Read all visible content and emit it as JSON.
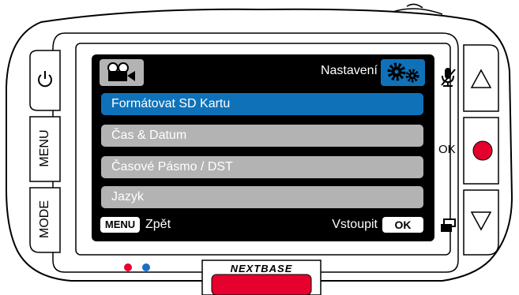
{
  "header": {
    "title": "Nastavení",
    "mode_icon": "video-camera-icon",
    "settings_icon": "gears-icon"
  },
  "menu": {
    "items": [
      {
        "label": "Formátovat SD Kartu",
        "selected": true
      },
      {
        "label": "Čas & Datum",
        "selected": false
      },
      {
        "label": "Časové Pásmo / DST",
        "selected": false
      },
      {
        "label": "Jazyk",
        "selected": false
      }
    ]
  },
  "footer": {
    "left_key": "MENU",
    "left_label": "Zpět",
    "right_label": "Vstoupit",
    "right_key": "OK"
  },
  "buttons": {
    "power_icon": "power-icon",
    "menu": "MENU",
    "mode": "MODE",
    "ok": "OK",
    "mic_icon": "mic-muted-icon",
    "up_icon": "triangle-up-icon",
    "down_icon": "triangle-down-icon",
    "protect_icon": "file-protect-icon"
  },
  "brand": {
    "logo": "NEXTBASE",
    "led_colors": [
      "#e6002d",
      "#1a6fc4"
    ],
    "accent": "#0f72b9",
    "record": "#e6002d"
  }
}
